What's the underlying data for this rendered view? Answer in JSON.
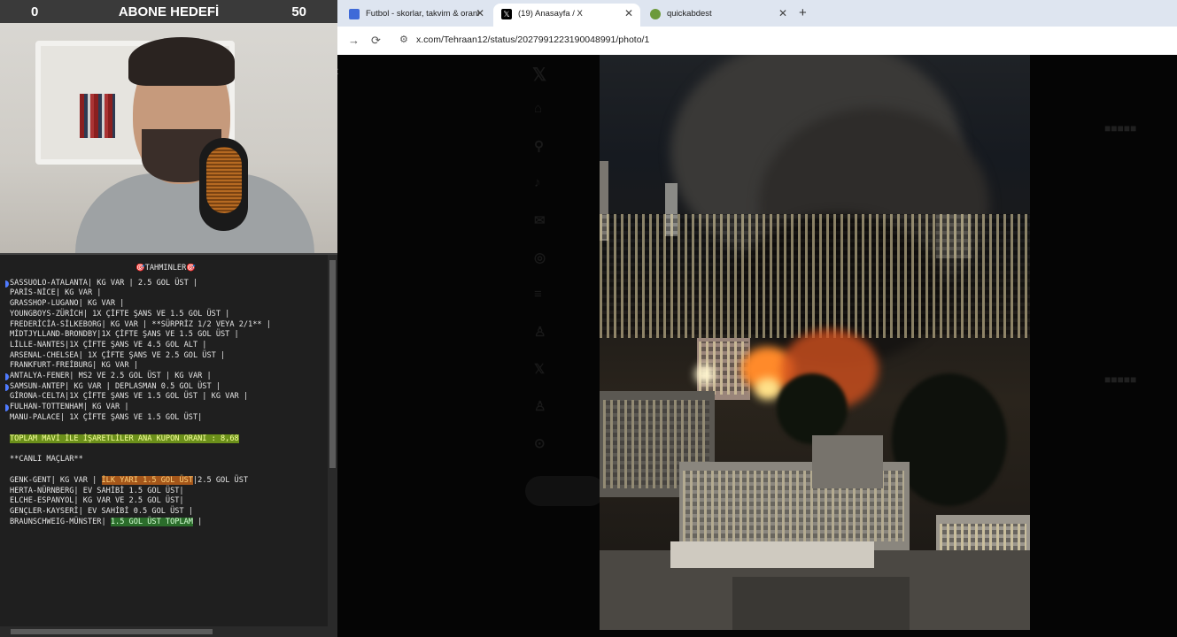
{
  "stream": {
    "goal_bar": {
      "current": "0",
      "label": "ABONE HEDEFİ",
      "target": "50",
      "progress_fraction": 0.0
    },
    "notes": {
      "title_icon": "🎯",
      "title": "TAHMİNLER",
      "predictions": [
        {
          "text": "SASSUOLO-ATALANTA| KG VAR | 2.5 GOL ÜST |",
          "marked": true
        },
        {
          "text": "PARİS-NİCE| KG VAR |",
          "marked": false
        },
        {
          "text": "GRASSHOP-LUGANO| KG VAR |",
          "marked": false
        },
        {
          "text": "YOUNGBOYS-ZÜRİCH| 1X ÇİFTE ŞANS VE 1.5 GOL ÜST |",
          "marked": false
        },
        {
          "text": "FREDERİCİA-SİLKEBORG| KG VAR | **SÜRPRİZ 1/2 VEYA 2/1** |",
          "marked": false
        },
        {
          "text": "MİDTJYLLAND-BRONDBY|1X ÇİFTE ŞANS VE 1.5 GOL ÜST |",
          "marked": false
        },
        {
          "text": "LİLLE-NANTES|1X ÇİFTE ŞANS VE 4.5 GOL ALT |",
          "marked": false
        },
        {
          "text": "ARSENAL-CHELSEA| 1X ÇİFTE ŞANS VE 2.5 GOL ÜST |",
          "marked": false
        },
        {
          "text": "FRANKFURT-FREİBURG| KG VAR |",
          "marked": false
        },
        {
          "text": "ANTALYA-FENER| MS2 VE 2.5 GOL ÜST | KG VAR |",
          "marked": true
        },
        {
          "text": "SAMSUN-ANTEP| KG VAR | DEPLASMAN 0.5 GOL ÜST |",
          "marked": true
        },
        {
          "text": "GİRONA-CELTA|1X ÇİFTE ŞANS VE 1.5 GOL ÜST | KG VAR |",
          "marked": false
        },
        {
          "text": "FULHAN-TOTTENHAM| KG VAR |",
          "marked": true
        },
        {
          "text": "MANU-PALACE| 1X ÇİFTE ŞANS VE 1.5 GOL ÜST|",
          "marked": false
        }
      ],
      "coupon_odds": "TOPLAM MAVİ İLE İŞARETLİLER ANA KUPON ORANI : 8,68",
      "live_header": "**CANLI MAÇLAR**",
      "live": [
        {
          "pre": "GENK-GENT| KG VAR |",
          "hl": "İLK YARI 1.5 GOL ÜST",
          "post": "|2.5 GOL ÜST",
          "hl_color": "orange"
        },
        {
          "pre": "HERTA-NÜRNBERG| EV SAHİBİ 1.5 GOL ÜST|",
          "hl": "",
          "post": ""
        },
        {
          "pre": "ELCHE-ESPANYOL| KG VAR VE 2.5 GOL ÜST|",
          "hl": "",
          "post": ""
        },
        {
          "pre": "GENÇLER-KAYSERİ| EV SAHİBİ 0.5 GOL ÜST |",
          "hl": "",
          "post": ""
        },
        {
          "pre": "BRAUNSCHWEIG-MÜNSTER|",
          "hl": "1.5 GOL ÜST TOPLAM",
          "post": " |",
          "hl_color": "green"
        }
      ]
    }
  },
  "browser": {
    "tabs": [
      {
        "label": "Futbol - skorlar, takvim & oranl",
        "icon": "flashscore-icon",
        "active": false
      },
      {
        "label": "(19) Anasayfa / X",
        "icon": "x-logo-icon",
        "active": true
      },
      {
        "label": "quickabdest",
        "icon": "frog-icon",
        "active": false
      }
    ],
    "new_tab_label": "+",
    "url": "x.com/Tehraan12/status/2027991223190048991/photo/1",
    "colors": {
      "tabstrip": "#dee5f0",
      "viewer_bg": "#000000",
      "marker_blue": "#4f7bff"
    }
  }
}
